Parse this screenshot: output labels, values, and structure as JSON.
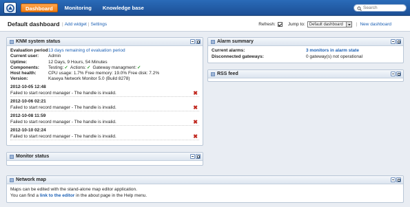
{
  "nav": {
    "tabs": [
      {
        "label": "Dashboard",
        "active": true
      },
      {
        "label": "Monitoring",
        "active": false
      },
      {
        "label": "Knowledge base",
        "active": false
      }
    ],
    "search_placeholder": "Search"
  },
  "toolbar": {
    "title": "Default dashboard",
    "add_widget": "Add widget",
    "settings": "Settings",
    "refresh_label": "Refresh:",
    "refresh_checked": true,
    "jump_label": "Jump to:",
    "jump_value": "Default dashboard",
    "new_dashboard": "New dashboard"
  },
  "knm": {
    "title": "KNM system status",
    "rows": {
      "evaluation_key": "Evaluation period",
      "evaluation_val": "13 days remaining of evaluation period",
      "user_key": "Current user:",
      "user_val": "Admin",
      "uptime_key": "Uptime:",
      "uptime_val": "12 Days, 9 Hours, 54 Minutes",
      "components_key": "Components:",
      "comp_testing": "Testing:",
      "comp_actions": "Actions:",
      "comp_gateway": "Gateway managment:",
      "health_key": "Host health:",
      "health_val": "CPU usage: 1.7% Free memory: 19.0% Free disk: 7.2%",
      "version_key": "Version:",
      "version_val": "Kaseya Network Monitor 5.0 (Build 8278)"
    },
    "events": [
      {
        "date": "2012-10-05 12:48",
        "message": "Failed to start record manager - The handle is invalid."
      },
      {
        "date": "2012-10-06 02:21",
        "message": "Failed to start record manager - The handle is invalid."
      },
      {
        "date": "2012-10-08 11:59",
        "message": "Failed to start record manager - The handle is invalid."
      },
      {
        "date": "2012-10-10 02:24",
        "message": "Failed to start record manager - The handle is invalid."
      }
    ]
  },
  "monitor": {
    "title": "Monitor status"
  },
  "alarm": {
    "title": "Alarm summary",
    "current_key": "Current alarms:",
    "current_val": "3 monitors in alarm state",
    "gateways_key": "Disconnected gateways:",
    "gateways_val": "0 gateway(s) not operational"
  },
  "rss": {
    "title": "RSS feed"
  },
  "map": {
    "title": "Network map",
    "line1": "Maps can be edited with the stand-alone map editor application.",
    "line2_pre": "You can find a",
    "line2_link": "link to the editor",
    "line2_post": "in the about page in the Help menu."
  },
  "colors": {
    "accent": "#f07c12",
    "bar": "#1c4f95",
    "link": "#1a5fb4",
    "error": "#c0261d",
    "ok": "#2c9a2c"
  }
}
